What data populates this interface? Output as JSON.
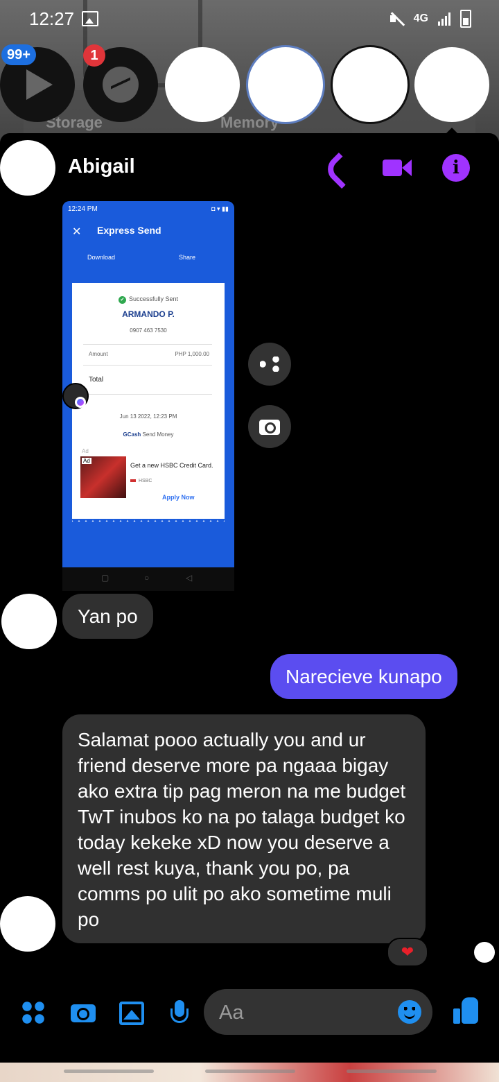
{
  "status_bar": {
    "time": "12:27",
    "network": "4G"
  },
  "chat_heads": {
    "storage_badge": "99+",
    "messenger_badge": "1",
    "background_labels": [
      "Storage",
      "Memory"
    ]
  },
  "conversation": {
    "contact_name": "Abigail",
    "icons": [
      "phone-icon",
      "video-camera-icon",
      "info-icon"
    ],
    "accent_color": "#a033ff"
  },
  "shared_image": {
    "status_time": "12:24 PM",
    "title": "Express Send",
    "download_label": "Download",
    "share_label": "Share",
    "status_text": "Successfully Sent",
    "recipient_name": "ARMANDO P.",
    "recipient_number": "0907 463 7530",
    "amount_label": "Amount",
    "amount_value": "PHP 1,000.00",
    "total_label": "Total",
    "datetime": "Jun 13 2022, 12:23 PM",
    "service_brand": "GCash",
    "service_text": "Send Money",
    "ad_label": "Ad",
    "ad_tag": "Ad",
    "ad_title": "Get a new HSBC Credit Card.",
    "ad_brand": "HSBC",
    "ad_cta": "Apply Now"
  },
  "messages": [
    {
      "direction": "incoming",
      "text": "Yan po"
    },
    {
      "direction": "outgoing",
      "text": "Narecieve kunapo"
    },
    {
      "direction": "incoming",
      "text": "Salamat pooo actually you and ur friend deserve more pa ngaaa bigay ako extra tip pag meron na me budget TwT inubos ko na po talaga budget ko today kekeke xD now you deserve a well rest kuya, thank you po, pa comms po ulit po ako sometime muli po"
    }
  ],
  "reaction": "❤",
  "composer": {
    "placeholder": "Aa"
  },
  "colors": {
    "outgoing_bubble": "#5b4df0",
    "incoming_bubble": "#303030",
    "composer_icons": "#1f8ff0"
  }
}
